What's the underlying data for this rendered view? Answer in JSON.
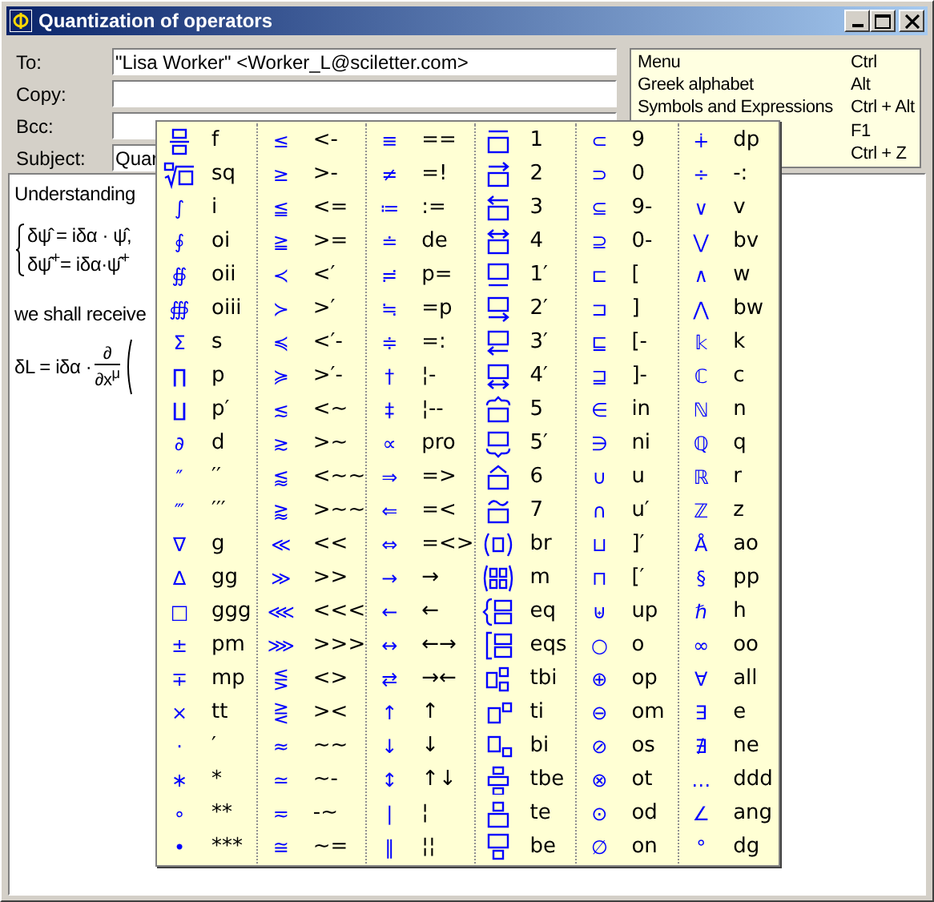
{
  "window": {
    "title": "Quantization of operators"
  },
  "header_fields": [
    {
      "label": "To:",
      "value": "\"Lisa Worker\" <Worker_L@sciletter.com>"
    },
    {
      "label": "Copy:"
    },
    {
      "label": "Bcc:"
    },
    {
      "label": "Subject:",
      "value": "Quar"
    }
  ],
  "hint_panel": [
    {
      "label": "Menu",
      "key": "Ctrl"
    },
    {
      "label": "Greek alphabet",
      "key": "Alt"
    },
    {
      "label": "Symbols and Expressions",
      "key": "Ctrl + Alt"
    },
    {
      "key": "F1"
    },
    {
      "key": "Ctrl + Z"
    }
  ],
  "editor": {
    "paragraph_1": "Understanding",
    "equations": [
      "δψ̂ = iδα · ψ̂,",
      "δψ̂$^{+}$= iδα·ψ̂$^{+}$"
    ],
    "paragraph_2": "we shall receive",
    "formula": {
      "lhs": "δL = iδα ·",
      "numerator": "∂",
      "denominator": "∂x$^{μ}$"
    }
  },
  "symbol_palette": {
    "columns": [
      [
        {
          "kind": "fraction",
          "shortcut": "f"
        },
        {
          "kind": "root",
          "shortcut": "sq"
        },
        {
          "kind": "glyph",
          "symbol": "∫",
          "shortcut": "i"
        },
        {
          "kind": "glyph",
          "symbol": "∮",
          "shortcut": "oi"
        },
        {
          "kind": "glyph",
          "symbol": "∯",
          "shortcut": "oii"
        },
        {
          "kind": "glyph",
          "symbol": "∰",
          "shortcut": "oiii"
        },
        {
          "kind": "glyph",
          "symbol": "Σ",
          "shortcut": "s"
        },
        {
          "kind": "glyph",
          "symbol": "∏",
          "shortcut": "p"
        },
        {
          "kind": "glyph",
          "symbol": "∐",
          "shortcut": "p′"
        },
        {
          "kind": "glyph",
          "symbol": "∂",
          "shortcut": "d"
        },
        {
          "kind": "glyph",
          "symbol": "″",
          "shortcut": "′′"
        },
        {
          "kind": "glyph",
          "symbol": "‴",
          "shortcut": "′′′"
        },
        {
          "kind": "glyph",
          "symbol": "∇",
          "shortcut": "g"
        },
        {
          "kind": "glyph",
          "symbol": "∆",
          "shortcut": "gg"
        },
        {
          "kind": "glyph",
          "symbol": "□",
          "shortcut": "ggg"
        },
        {
          "kind": "glyph",
          "symbol": "±",
          "shortcut": "pm"
        },
        {
          "kind": "glyph",
          "symbol": "∓",
          "shortcut": "mp"
        },
        {
          "kind": "glyph",
          "symbol": "×",
          "shortcut": "tt"
        },
        {
          "kind": "glyph",
          "symbol": "·",
          "shortcut": "′"
        },
        {
          "kind": "glyph",
          "symbol": "∗",
          "shortcut": "*"
        },
        {
          "kind": "glyph",
          "symbol": "∘",
          "shortcut": "**"
        },
        {
          "kind": "glyph",
          "symbol": "•",
          "shortcut": "***"
        }
      ],
      [
        {
          "kind": "glyph",
          "symbol": "≤",
          "shortcut": "<-"
        },
        {
          "kind": "glyph",
          "symbol": "≥",
          "shortcut": ">-"
        },
        {
          "kind": "glyph",
          "symbol": "≦",
          "shortcut": "<="
        },
        {
          "kind": "glyph",
          "symbol": "≧",
          "shortcut": ">="
        },
        {
          "kind": "glyph",
          "symbol": "≺",
          "shortcut": "<′"
        },
        {
          "kind": "glyph",
          "symbol": "≻",
          "shortcut": ">′"
        },
        {
          "kind": "glyph",
          "symbol": "≼",
          "shortcut": "<′-"
        },
        {
          "kind": "glyph",
          "symbol": "≽",
          "shortcut": ">′-"
        },
        {
          "kind": "glyph",
          "symbol": "≲",
          "shortcut": "<~"
        },
        {
          "kind": "glyph",
          "symbol": "≳",
          "shortcut": ">~"
        },
        {
          "kind": "glyph",
          "symbol": "⪅",
          "shortcut": "<~~"
        },
        {
          "kind": "glyph",
          "symbol": "⪆",
          "shortcut": ">~~"
        },
        {
          "kind": "glyph",
          "symbol": "≪",
          "shortcut": "<<"
        },
        {
          "kind": "glyph",
          "symbol": "≫",
          "shortcut": ">>"
        },
        {
          "kind": "glyph",
          "symbol": "⋘",
          "shortcut": "<<<"
        },
        {
          "kind": "glyph",
          "symbol": "⋙",
          "shortcut": ">>>"
        },
        {
          "kind": "glyph",
          "symbol": "⋚",
          "shortcut": "<>"
        },
        {
          "kind": "glyph",
          "symbol": "⋛",
          "shortcut": "><"
        },
        {
          "kind": "glyph",
          "symbol": "≈",
          "shortcut": "~~"
        },
        {
          "kind": "glyph",
          "symbol": "≃",
          "shortcut": "~-"
        },
        {
          "kind": "glyph",
          "symbol": "≂",
          "shortcut": "-~"
        },
        {
          "kind": "glyph",
          "symbol": "≅",
          "shortcut": "~="
        }
      ],
      [
        {
          "kind": "glyph",
          "symbol": "≡",
          "shortcut": "=="
        },
        {
          "kind": "glyph",
          "symbol": "≠",
          "shortcut": "=!"
        },
        {
          "kind": "glyph",
          "symbol": "≔",
          "shortcut": ":="
        },
        {
          "kind": "glyph",
          "symbol": "≐",
          "shortcut": "de"
        },
        {
          "kind": "glyph",
          "symbol": "≓",
          "shortcut": "p="
        },
        {
          "kind": "glyph",
          "symbol": "≒",
          "shortcut": "=p"
        },
        {
          "kind": "glyph",
          "symbol": "≑",
          "shortcut": "=:"
        },
        {
          "kind": "glyph",
          "symbol": "†",
          "shortcut": "¦-"
        },
        {
          "kind": "glyph",
          "symbol": "‡",
          "shortcut": "¦--"
        },
        {
          "kind": "glyph",
          "symbol": "∝",
          "shortcut": "pro"
        },
        {
          "kind": "glyph",
          "symbol": "⇒",
          "shortcut": "=>"
        },
        {
          "kind": "glyph",
          "symbol": "⇐",
          "shortcut": "=<"
        },
        {
          "kind": "glyph",
          "symbol": "⇔",
          "shortcut": "=<>"
        },
        {
          "kind": "glyph",
          "symbol": "→",
          "shortcut": "→"
        },
        {
          "kind": "glyph",
          "symbol": "←",
          "shortcut": "←"
        },
        {
          "kind": "glyph",
          "symbol": "↔",
          "shortcut": "←→"
        },
        {
          "kind": "glyph",
          "symbol": "⇄",
          "shortcut": "→←"
        },
        {
          "kind": "glyph",
          "symbol": "↑",
          "shortcut": "↑"
        },
        {
          "kind": "glyph",
          "symbol": "↓",
          "shortcut": "↓"
        },
        {
          "kind": "glyph",
          "symbol": "↕",
          "shortcut": "↑↓"
        },
        {
          "kind": "glyph",
          "symbol": "|",
          "shortcut": "¦"
        },
        {
          "kind": "glyph",
          "symbol": "‖",
          "shortcut": "¦¦"
        }
      ],
      [
        {
          "kind": "overbar",
          "shortcut": "1"
        },
        {
          "kind": "overright",
          "shortcut": "2"
        },
        {
          "kind": "overleft",
          "shortcut": "3"
        },
        {
          "kind": "overboth",
          "shortcut": "4"
        },
        {
          "kind": "underbar",
          "shortcut": "1′"
        },
        {
          "kind": "underright",
          "shortcut": "2′"
        },
        {
          "kind": "underleft",
          "shortcut": "3′"
        },
        {
          "kind": "underboth",
          "shortcut": "4′"
        },
        {
          "kind": "overbrace",
          "shortcut": "5"
        },
        {
          "kind": "underbrace",
          "shortcut": "5′"
        },
        {
          "kind": "overhat",
          "shortcut": "6"
        },
        {
          "kind": "overtilde",
          "shortcut": "7"
        },
        {
          "kind": "parens",
          "shortcut": "br"
        },
        {
          "kind": "matrix",
          "shortcut": "m"
        },
        {
          "kind": "cases",
          "shortcut": "eq"
        },
        {
          "kind": "brackets",
          "shortcut": "eqs"
        },
        {
          "kind": "sidescripts",
          "shortcut": "tbi"
        },
        {
          "kind": "superscript",
          "shortcut": "ti"
        },
        {
          "kind": "subscript",
          "shortcut": "bi"
        },
        {
          "kind": "limits",
          "shortcut": "tbe"
        },
        {
          "kind": "over",
          "shortcut": "te"
        },
        {
          "kind": "under",
          "shortcut": "be"
        }
      ],
      [
        {
          "kind": "glyph",
          "symbol": "⊂",
          "shortcut": "9"
        },
        {
          "kind": "glyph",
          "symbol": "⊃",
          "shortcut": "0"
        },
        {
          "kind": "glyph",
          "symbol": "⊆",
          "shortcut": "9-"
        },
        {
          "kind": "glyph",
          "symbol": "⊇",
          "shortcut": "0-"
        },
        {
          "kind": "glyph",
          "symbol": "⊏",
          "shortcut": "["
        },
        {
          "kind": "glyph",
          "symbol": "⊐",
          "shortcut": "]"
        },
        {
          "kind": "glyph",
          "symbol": "⊑",
          "shortcut": "[-"
        },
        {
          "kind": "glyph",
          "symbol": "⊒",
          "shortcut": "]-"
        },
        {
          "kind": "glyph",
          "symbol": "∈",
          "shortcut": "in"
        },
        {
          "kind": "glyph",
          "symbol": "∋",
          "shortcut": "ni"
        },
        {
          "kind": "glyph",
          "symbol": "∪",
          "shortcut": "u"
        },
        {
          "kind": "glyph",
          "symbol": "∩",
          "shortcut": "u′"
        },
        {
          "kind": "glyph",
          "symbol": "⊔",
          "shortcut": "]′"
        },
        {
          "kind": "glyph",
          "symbol": "⊓",
          "shortcut": "[′"
        },
        {
          "kind": "glyph",
          "symbol": "⊎",
          "shortcut": "up"
        },
        {
          "kind": "glyph",
          "symbol": "○",
          "shortcut": "o"
        },
        {
          "kind": "glyph",
          "symbol": "⊕",
          "shortcut": "op"
        },
        {
          "kind": "glyph",
          "symbol": "⊖",
          "shortcut": "om"
        },
        {
          "kind": "glyph",
          "symbol": "⊘",
          "shortcut": "os"
        },
        {
          "kind": "glyph",
          "symbol": "⊗",
          "shortcut": "ot"
        },
        {
          "kind": "glyph",
          "symbol": "⊙",
          "shortcut": "od"
        },
        {
          "kind": "glyph",
          "symbol": "∅",
          "shortcut": "on"
        }
      ],
      [
        {
          "kind": "glyph",
          "symbol": "∔",
          "shortcut": "dp"
        },
        {
          "kind": "glyph",
          "symbol": "÷",
          "shortcut": "-:"
        },
        {
          "kind": "glyph",
          "symbol": "∨",
          "shortcut": "v"
        },
        {
          "kind": "glyph",
          "symbol": "⋁",
          "shortcut": "bv"
        },
        {
          "kind": "glyph",
          "symbol": "∧",
          "shortcut": "w"
        },
        {
          "kind": "glyph",
          "symbol": "⋀",
          "shortcut": "bw"
        },
        {
          "kind": "glyph",
          "symbol": "𝕜",
          "shortcut": "k"
        },
        {
          "kind": "glyph",
          "symbol": "ℂ",
          "shortcut": "c"
        },
        {
          "kind": "glyph",
          "symbol": "ℕ",
          "shortcut": "n"
        },
        {
          "kind": "glyph",
          "symbol": "ℚ",
          "shortcut": "q"
        },
        {
          "kind": "glyph",
          "symbol": "ℝ",
          "shortcut": "r"
        },
        {
          "kind": "glyph",
          "symbol": "ℤ",
          "shortcut": "z"
        },
        {
          "kind": "glyph",
          "symbol": "Å",
          "shortcut": "ao"
        },
        {
          "kind": "glyph",
          "symbol": "§",
          "shortcut": "pp"
        },
        {
          "kind": "glyph",
          "symbol": "ℏ",
          "shortcut": "h"
        },
        {
          "kind": "glyph",
          "symbol": "∞",
          "shortcut": "oo"
        },
        {
          "kind": "glyph",
          "symbol": "∀",
          "shortcut": "all"
        },
        {
          "kind": "glyph",
          "symbol": "∃",
          "shortcut": "e"
        },
        {
          "kind": "glyph",
          "symbol": "∄",
          "shortcut": "ne"
        },
        {
          "kind": "glyph",
          "symbol": "…",
          "shortcut": "ddd"
        },
        {
          "kind": "glyph",
          "symbol": "∠",
          "shortcut": "ang"
        },
        {
          "kind": "glyph",
          "symbol": "°",
          "shortcut": "dg"
        }
      ]
    ]
  }
}
